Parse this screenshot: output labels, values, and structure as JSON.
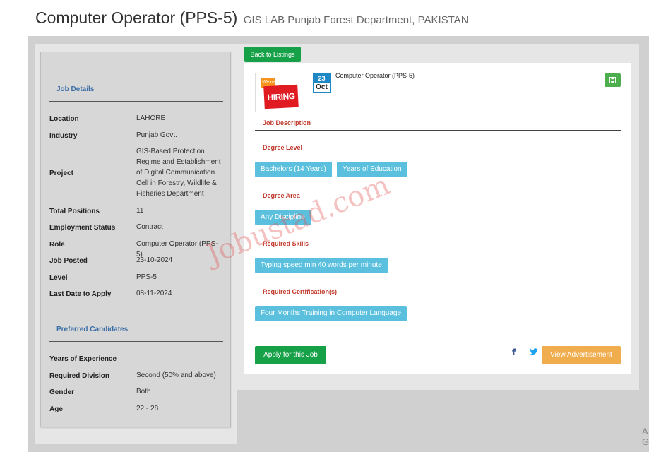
{
  "header": {
    "title": "Computer Operator (PPS-5)",
    "subtitle": "GIS LAB Punjab Forest Department, PAKISTAN"
  },
  "sidebar": {
    "job_details_heading": "Job Details",
    "job_details": [
      {
        "label": "Location",
        "value": "LAHORE"
      },
      {
        "label": "Industry",
        "value": "Punjab Govt."
      },
      {
        "label": "Project",
        "value": "GIS-Based Protection Regime and Establishment of Digital Communication Cell in Forestry, Wildlife & Fisheries Department"
      },
      {
        "label": "Total Positions",
        "value": "11"
      },
      {
        "label": "Employment Status",
        "value": "Contract"
      },
      {
        "label": "Role",
        "value": "Computer Operator (PPS-5)"
      },
      {
        "label": "Job Posted",
        "value": "23-10-2024"
      },
      {
        "label": "Level",
        "value": "PPS-5"
      },
      {
        "label": "Last Date to Apply",
        "value": "08-11-2024"
      }
    ],
    "preferred_heading": "Preferred Candidates",
    "preferred": [
      {
        "label": "Years of Experience",
        "value": ""
      },
      {
        "label": "Required Division",
        "value": "Second (50% and above)"
      },
      {
        "label": "Gender",
        "value": "Both"
      },
      {
        "label": "Age",
        "value": "22 - 28"
      }
    ]
  },
  "card": {
    "back_label": "Back to Listings",
    "logo": {
      "top": "We're",
      "main": "HIRING"
    },
    "date": {
      "day": "23",
      "month": "Oct"
    },
    "job_title": "Computer Operator (PPS-5)",
    "save_icon": "floppy-disk-icon",
    "sections": {
      "description": "Job Description",
      "degree_level": "Degree Level",
      "degree_area": "Degree Area",
      "skills": "Required Skills",
      "certification": "Required Certification(s)"
    },
    "degree_level_tags": [
      "Bachelors (14 Years)",
      "Years of Education"
    ],
    "degree_area_tags": [
      "Any Discipline"
    ],
    "skills_tags": [
      "Typing speed min 40 words per minute"
    ],
    "certification_tags": [
      "Four Months Training in Computer Language"
    ],
    "apply_label": "Apply for this Job",
    "facebook_icon": "f",
    "view_label": "View Advertisement",
    "tag_color": "#5bc0de",
    "accent_green": "#16a047"
  },
  "watermark": "Jobustad.com",
  "corner_text": "A\nG"
}
